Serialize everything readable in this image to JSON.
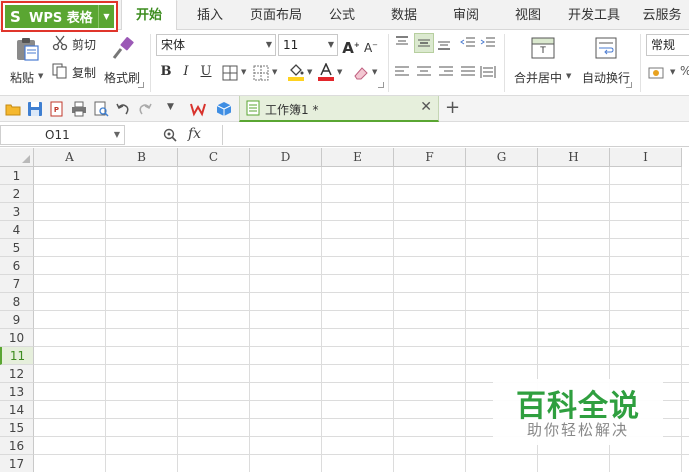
{
  "app": {
    "name": "WPS 表格"
  },
  "menu": {
    "tabs": [
      {
        "label": "开始",
        "active": true
      },
      {
        "label": "插入"
      },
      {
        "label": "页面布局"
      },
      {
        "label": "公式"
      },
      {
        "label": "数据"
      },
      {
        "label": "审阅"
      },
      {
        "label": "视图"
      },
      {
        "label": "开发工具"
      },
      {
        "label": "云服务"
      }
    ]
  },
  "ribbon": {
    "paste": "粘贴",
    "cut": "剪切",
    "copy": "复制",
    "format_painter": "格式刷",
    "font_name": "宋体",
    "font_size": "11",
    "bold": "B",
    "italic": "I",
    "underline": "U",
    "merge_center": "合并居中",
    "wrap_text": "自动换行",
    "number_format": "常规"
  },
  "document": {
    "tab_title": "工作簿1 *"
  },
  "formula_bar": {
    "cell_ref": "O11",
    "fx": "fx"
  },
  "sheet": {
    "columns": [
      "A",
      "B",
      "C",
      "D",
      "E",
      "F",
      "G",
      "H",
      "I"
    ],
    "rows": [
      "1",
      "2",
      "3",
      "4",
      "5",
      "6",
      "7",
      "8",
      "9",
      "10",
      "11",
      "12",
      "13",
      "14",
      "15",
      "16",
      "17"
    ],
    "selected_row": "11"
  },
  "watermark": {
    "title": "百科全说",
    "subtitle": "助你轻松解决"
  },
  "colors": {
    "accent": "#5aa632",
    "highlight": "#e0352b",
    "watermark": "#2f9f3f"
  }
}
